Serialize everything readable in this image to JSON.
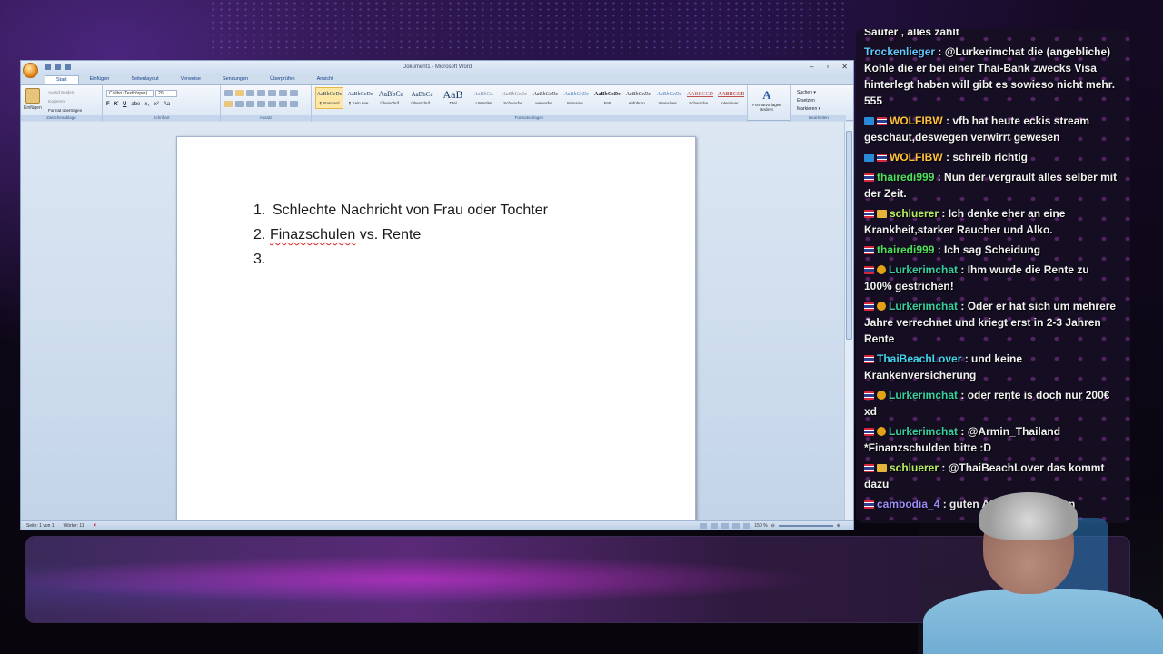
{
  "word": {
    "window_title": "Dokument1 - Microsoft Word",
    "tabs": [
      "Start",
      "Einfügen",
      "Seitenlayout",
      "Verweise",
      "Sendungen",
      "Überprüfen",
      "Ansicht"
    ],
    "clipboard": {
      "paste_label": "Einfügen",
      "cut_label": "Ausschneiden",
      "copy_label": "Kopieren",
      "format_painter_label": "Format übertragen",
      "group_label": "Zwischenablage"
    },
    "font": {
      "font_name": "Calibri (Textkörper)",
      "font_size": "20",
      "group_label": "Schriftart",
      "format_buttons": [
        "F",
        "K",
        "U",
        "abe",
        "x₂",
        "x²",
        "Aa"
      ]
    },
    "paragraph": {
      "group_label": "Absatz"
    },
    "styles": {
      "group_label": "Formatvorlagen",
      "change_label": "Formatvorlagen ändern",
      "items": [
        {
          "sample": "AaBbCcDc",
          "name": "¶ Standard"
        },
        {
          "sample": "AaBbCcDc",
          "name": "¶ Kein Lee..."
        },
        {
          "sample": "AaBbCc",
          "name": "Überschrif..."
        },
        {
          "sample": "AaBbCc",
          "name": "Überschrif..."
        },
        {
          "sample": "AaB",
          "name": "Titel"
        },
        {
          "sample": "AaBbCc.",
          "name": "Untertitel"
        },
        {
          "sample": "AaBbCcDc",
          "name": "Schwache..."
        },
        {
          "sample": "AaBbCcDc",
          "name": "Hervorhe..."
        },
        {
          "sample": "AaBbCcDc",
          "name": "Intensive..."
        },
        {
          "sample": "AaBbCcDc",
          "name": "Fett"
        },
        {
          "sample": "AaBbCcDc",
          "name": "Anführun..."
        },
        {
          "sample": "AaBbCcDc",
          "name": "Intensives..."
        },
        {
          "sample": "AABBCCDI",
          "name": "Schwache..."
        },
        {
          "sample": "AABBCCDI",
          "name": "Intensiver..."
        }
      ]
    },
    "editing": {
      "group_label": "Bearbeiten",
      "items": [
        "Suchen ▾",
        "Ersetzen",
        "Markieren ▾"
      ]
    },
    "document": {
      "lines": [
        {
          "num": "1.",
          "text": "Schlechte Nachricht von Frau oder Tochter"
        },
        {
          "num": "2.",
          "text_misspelled": "Finazschulen",
          "text_rest": " vs. Rente"
        },
        {
          "num": "3.",
          "text": ""
        }
      ]
    },
    "status": {
      "page": "Seite: 1 von 1",
      "words": "Wörter: 11",
      "zoom": "150 %"
    }
  },
  "chat": {
    "messages": [
      {
        "user": "",
        "text": "Säufer , alles zahlt",
        "badges": [],
        "color": ""
      },
      {
        "user": "Trockenlieger",
        "text": "@Lurkerimchat die (angebliche) Kohle die er bei einer Thai-Bank zwecks Visa hinterlegt haben will gibt es sowieso nicht mehr. 555",
        "badges": [],
        "color": "c-trocken"
      },
      {
        "user": "WOLFIBW",
        "text": "vfb hat heute eckis stream geschaut,deswegen verwirrt gewesen",
        "badges": [
          "prime",
          "flag"
        ],
        "color": "c-wolf"
      },
      {
        "user": "WOLFIBW",
        "text": "schreib richtig",
        "badges": [
          "prime",
          "flag"
        ],
        "color": "c-wolf"
      },
      {
        "user": "thairedi999",
        "text": "Nun der vergrault alles selber mit der Zeit.",
        "badges": [
          "flag"
        ],
        "color": "c-thai"
      },
      {
        "user": "schluerer",
        "text": "Ich denke eher an eine Krankheit,starker Raucher und Alko.",
        "badges": [
          "flag",
          "crown"
        ],
        "color": "c-schl"
      },
      {
        "user": "thairedi999",
        "text": "Ich sag Scheidung",
        "badges": [
          "flag"
        ],
        "color": "c-thai"
      },
      {
        "user": "Lurkerimchat",
        "text": "Ihm wurde die Rente zu 100% gestrichen!",
        "badges": [
          "flag",
          "sub"
        ],
        "color": "c-lurk"
      },
      {
        "user": "Lurkerimchat",
        "text": "Oder er hat sich um mehrere Jahre verrechnet und kriegt erst in 2-3 Jahren Rente",
        "badges": [
          "flag",
          "sub"
        ],
        "color": "c-lurk"
      },
      {
        "user": "ThaiBeachLover",
        "text": "und keine Krankenversicherung",
        "badges": [
          "flag"
        ],
        "color": "c-beach"
      },
      {
        "user": "Lurkerimchat",
        "text": "oder rente is doch nur 200€ xd",
        "badges": [
          "flag",
          "sub"
        ],
        "color": "c-lurk"
      },
      {
        "user": "Lurkerimchat",
        "text": "@Armin_Thailand *Finanzschulden bitte :D",
        "badges": [
          "flag",
          "sub"
        ],
        "color": "c-lurk"
      },
      {
        "user": "schluerer",
        "text": "@ThaiBeachLover das kommt dazu",
        "badges": [
          "flag",
          "crown"
        ],
        "color": "c-schl"
      },
      {
        "user": "cambodia_4",
        "text": "guten Abend zusammen",
        "badges": [
          "flag"
        ],
        "color": "c-camb"
      }
    ]
  }
}
